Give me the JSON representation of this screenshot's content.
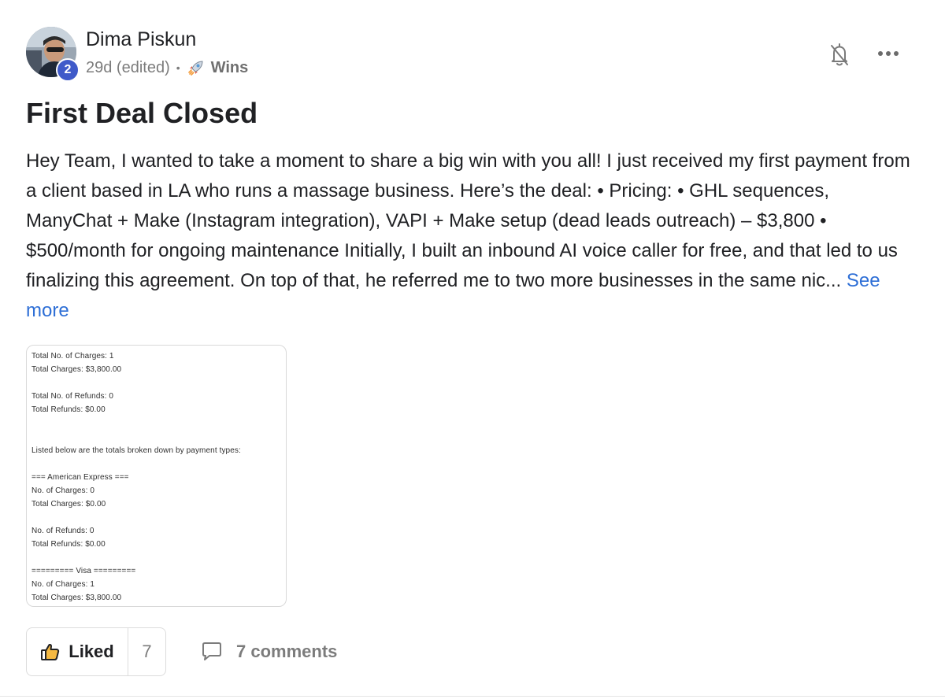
{
  "author": {
    "name": "Dima Piskun",
    "level": "2"
  },
  "meta": {
    "time": "29d (edited)",
    "separator": "•",
    "category": "Wins",
    "category_icon": "rocket-icon"
  },
  "header_actions": {
    "bell_icon": "bell-off-icon",
    "more_icon": "more-horizontal-icon"
  },
  "post": {
    "title": "First Deal Closed",
    "body": "Hey Team, I wanted to take a moment to share a big win with you all! I just received my first payment from a client based in LA who runs a massage business. Here’s the deal: • Pricing: • GHL sequences, ManyChat + Make (Instagram integration), VAPI + Make setup (dead leads outreach) – $3,800 • $500/month for ongoing maintenance Initially, I built an inbound AI voice caller for free, and that led to us finalizing this agreement. On top of that, he referred me to two more businesses in the same nic...",
    "see_more": "See more"
  },
  "attachment": {
    "lines": [
      "Total No. of Charges: 1",
      "Total Charges: $3,800.00",
      "Total No. of Refunds: 0",
      "Total Refunds: $0.00",
      "Listed below are the totals broken down by payment types:",
      "=== American Express ===",
      "No. of Charges: 0",
      "Total Charges: $0.00",
      "No. of Refunds: 0",
      "Total Refunds: $0.00",
      "========= Visa =========",
      "No. of Charges: 1",
      "Total Charges: $3,800.00"
    ]
  },
  "actions": {
    "like_label": "Liked",
    "like_count": "7",
    "like_icon": "thumbs-up-icon",
    "comments_label": "7 comments",
    "comments_icon": "comment-icon"
  },
  "colors": {
    "link": "#2e6fd6",
    "badge": "#3f5ac9",
    "muted": "#7c7c7c",
    "text": "#202124",
    "border": "#dcdcdc"
  }
}
